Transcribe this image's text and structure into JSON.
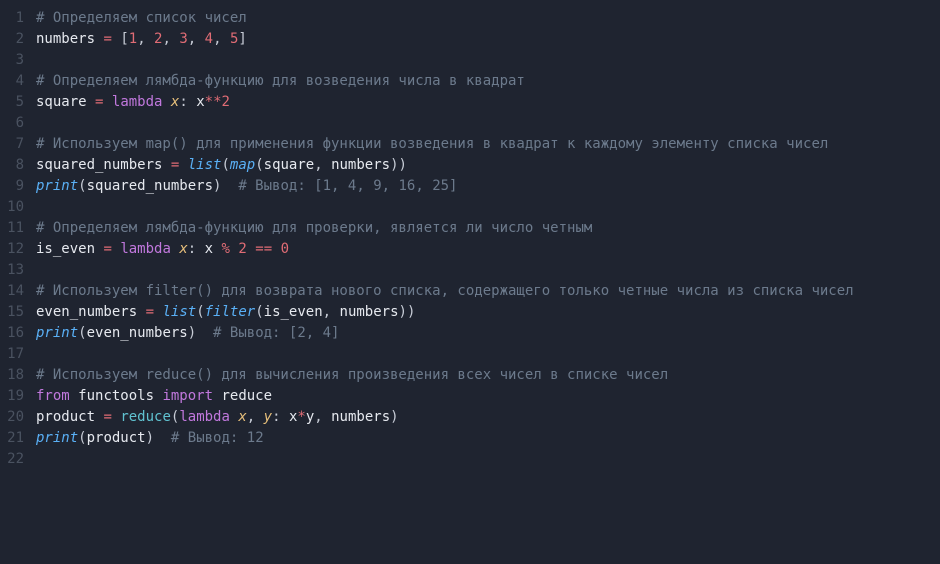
{
  "lines": [
    {
      "n": "1",
      "tokens": [
        {
          "c": "tok-comment",
          "t": "# Определяем список чисел"
        }
      ]
    },
    {
      "n": "2",
      "tokens": [
        {
          "c": "tok-ident",
          "t": "numbers"
        },
        {
          "c": "tok-punct",
          "t": " "
        },
        {
          "c": "tok-op",
          "t": "="
        },
        {
          "c": "tok-punct",
          "t": " ["
        },
        {
          "c": "tok-num",
          "t": "1"
        },
        {
          "c": "tok-punct",
          "t": ", "
        },
        {
          "c": "tok-num",
          "t": "2"
        },
        {
          "c": "tok-punct",
          "t": ", "
        },
        {
          "c": "tok-num",
          "t": "3"
        },
        {
          "c": "tok-punct",
          "t": ", "
        },
        {
          "c": "tok-num",
          "t": "4"
        },
        {
          "c": "tok-punct",
          "t": ", "
        },
        {
          "c": "tok-num",
          "t": "5"
        },
        {
          "c": "tok-punct",
          "t": "]"
        }
      ]
    },
    {
      "n": "3",
      "tokens": [
        {
          "c": "tok-punct",
          "t": ""
        }
      ]
    },
    {
      "n": "4",
      "tokens": [
        {
          "c": "tok-comment",
          "t": "# Определяем лямбда-функцию для возведения числа в квадрат"
        }
      ]
    },
    {
      "n": "5",
      "tokens": [
        {
          "c": "tok-ident",
          "t": "square"
        },
        {
          "c": "tok-punct",
          "t": " "
        },
        {
          "c": "tok-op",
          "t": "="
        },
        {
          "c": "tok-punct",
          "t": " "
        },
        {
          "c": "tok-kw",
          "t": "lambda"
        },
        {
          "c": "tok-punct",
          "t": " "
        },
        {
          "c": "tok-param",
          "t": "x"
        },
        {
          "c": "tok-punct",
          "t": ": "
        },
        {
          "c": "tok-ident",
          "t": "x"
        },
        {
          "c": "tok-op",
          "t": "**"
        },
        {
          "c": "tok-num",
          "t": "2"
        }
      ]
    },
    {
      "n": "6",
      "tokens": [
        {
          "c": "tok-punct",
          "t": ""
        }
      ]
    },
    {
      "n": "7",
      "tokens": [
        {
          "c": "tok-comment",
          "t": "# Используем map() для применения функции возведения в квадрат к каждому элементу списка чисел"
        }
      ]
    },
    {
      "n": "8",
      "tokens": [
        {
          "c": "tok-ident",
          "t": "squared_numbers"
        },
        {
          "c": "tok-punct",
          "t": " "
        },
        {
          "c": "tok-op",
          "t": "="
        },
        {
          "c": "tok-punct",
          "t": " "
        },
        {
          "c": "tok-builtin",
          "t": "list"
        },
        {
          "c": "tok-punct",
          "t": "("
        },
        {
          "c": "tok-builtin",
          "t": "map"
        },
        {
          "c": "tok-punct",
          "t": "("
        },
        {
          "c": "tok-ident",
          "t": "square"
        },
        {
          "c": "tok-punct",
          "t": ", "
        },
        {
          "c": "tok-ident",
          "t": "numbers"
        },
        {
          "c": "tok-punct",
          "t": "))"
        }
      ]
    },
    {
      "n": "9",
      "tokens": [
        {
          "c": "tok-builtin",
          "t": "print"
        },
        {
          "c": "tok-punct",
          "t": "("
        },
        {
          "c": "tok-ident",
          "t": "squared_numbers"
        },
        {
          "c": "tok-punct",
          "t": ")  "
        },
        {
          "c": "tok-comment",
          "t": "# Вывод: [1, 4, 9, 16, 25]"
        }
      ]
    },
    {
      "n": "10",
      "tokens": [
        {
          "c": "tok-punct",
          "t": ""
        }
      ]
    },
    {
      "n": "11",
      "tokens": [
        {
          "c": "tok-comment",
          "t": "# Определяем лямбда-функцию для проверки, является ли число четным"
        }
      ]
    },
    {
      "n": "12",
      "tokens": [
        {
          "c": "tok-ident",
          "t": "is_even"
        },
        {
          "c": "tok-punct",
          "t": " "
        },
        {
          "c": "tok-op",
          "t": "="
        },
        {
          "c": "tok-punct",
          "t": " "
        },
        {
          "c": "tok-kw",
          "t": "lambda"
        },
        {
          "c": "tok-punct",
          "t": " "
        },
        {
          "c": "tok-param",
          "t": "x"
        },
        {
          "c": "tok-punct",
          "t": ": "
        },
        {
          "c": "tok-ident",
          "t": "x"
        },
        {
          "c": "tok-punct",
          "t": " "
        },
        {
          "c": "tok-op",
          "t": "%"
        },
        {
          "c": "tok-punct",
          "t": " "
        },
        {
          "c": "tok-num",
          "t": "2"
        },
        {
          "c": "tok-punct",
          "t": " "
        },
        {
          "c": "tok-op",
          "t": "=="
        },
        {
          "c": "tok-punct",
          "t": " "
        },
        {
          "c": "tok-num",
          "t": "0"
        }
      ]
    },
    {
      "n": "13",
      "tokens": [
        {
          "c": "tok-punct",
          "t": ""
        }
      ]
    },
    {
      "n": "14",
      "tokens": [
        {
          "c": "tok-comment",
          "t": "# Используем filter() для возврата нового списка, содержащего только четные числа из списка чисел"
        }
      ]
    },
    {
      "n": "15",
      "tokens": [
        {
          "c": "tok-ident",
          "t": "even_numbers"
        },
        {
          "c": "tok-punct",
          "t": " "
        },
        {
          "c": "tok-op",
          "t": "="
        },
        {
          "c": "tok-punct",
          "t": " "
        },
        {
          "c": "tok-builtin",
          "t": "list"
        },
        {
          "c": "tok-punct",
          "t": "("
        },
        {
          "c": "tok-builtin",
          "t": "filter"
        },
        {
          "c": "tok-punct",
          "t": "("
        },
        {
          "c": "tok-ident",
          "t": "is_even"
        },
        {
          "c": "tok-punct",
          "t": ", "
        },
        {
          "c": "tok-ident",
          "t": "numbers"
        },
        {
          "c": "tok-punct",
          "t": "))"
        }
      ]
    },
    {
      "n": "16",
      "tokens": [
        {
          "c": "tok-builtin",
          "t": "print"
        },
        {
          "c": "tok-punct",
          "t": "("
        },
        {
          "c": "tok-ident",
          "t": "even_numbers"
        },
        {
          "c": "tok-punct",
          "t": ")  "
        },
        {
          "c": "tok-comment",
          "t": "# Вывод: [2, 4]"
        }
      ]
    },
    {
      "n": "17",
      "tokens": [
        {
          "c": "tok-punct",
          "t": ""
        }
      ]
    },
    {
      "n": "18",
      "tokens": [
        {
          "c": "tok-comment",
          "t": "# Используем reduce() для вычисления произведения всех чисел в списке чисел"
        }
      ]
    },
    {
      "n": "19",
      "tokens": [
        {
          "c": "tok-kw",
          "t": "from"
        },
        {
          "c": "tok-punct",
          "t": " "
        },
        {
          "c": "tok-ident",
          "t": "functools"
        },
        {
          "c": "tok-punct",
          "t": " "
        },
        {
          "c": "tok-kw",
          "t": "import"
        },
        {
          "c": "tok-punct",
          "t": " "
        },
        {
          "c": "tok-ident",
          "t": "reduce"
        }
      ]
    },
    {
      "n": "20",
      "tokens": [
        {
          "c": "tok-ident",
          "t": "product"
        },
        {
          "c": "tok-punct",
          "t": " "
        },
        {
          "c": "tok-op",
          "t": "="
        },
        {
          "c": "tok-punct",
          "t": " "
        },
        {
          "c": "tok-func",
          "t": "reduce"
        },
        {
          "c": "tok-punct",
          "t": "("
        },
        {
          "c": "tok-kw",
          "t": "lambda"
        },
        {
          "c": "tok-punct",
          "t": " "
        },
        {
          "c": "tok-param",
          "t": "x"
        },
        {
          "c": "tok-punct",
          "t": ", "
        },
        {
          "c": "tok-param",
          "t": "y"
        },
        {
          "c": "tok-punct",
          "t": ": "
        },
        {
          "c": "tok-ident",
          "t": "x"
        },
        {
          "c": "tok-op",
          "t": "*"
        },
        {
          "c": "tok-ident",
          "t": "y"
        },
        {
          "c": "tok-punct",
          "t": ", "
        },
        {
          "c": "tok-ident",
          "t": "numbers"
        },
        {
          "c": "tok-punct",
          "t": ")"
        }
      ]
    },
    {
      "n": "21",
      "tokens": [
        {
          "c": "tok-builtin",
          "t": "print"
        },
        {
          "c": "tok-punct",
          "t": "("
        },
        {
          "c": "tok-ident",
          "t": "product"
        },
        {
          "c": "tok-punct",
          "t": ")  "
        },
        {
          "c": "tok-comment",
          "t": "# Вывод: 12"
        }
      ]
    },
    {
      "n": "22",
      "tokens": [
        {
          "c": "tok-punct",
          "t": ""
        }
      ]
    }
  ]
}
